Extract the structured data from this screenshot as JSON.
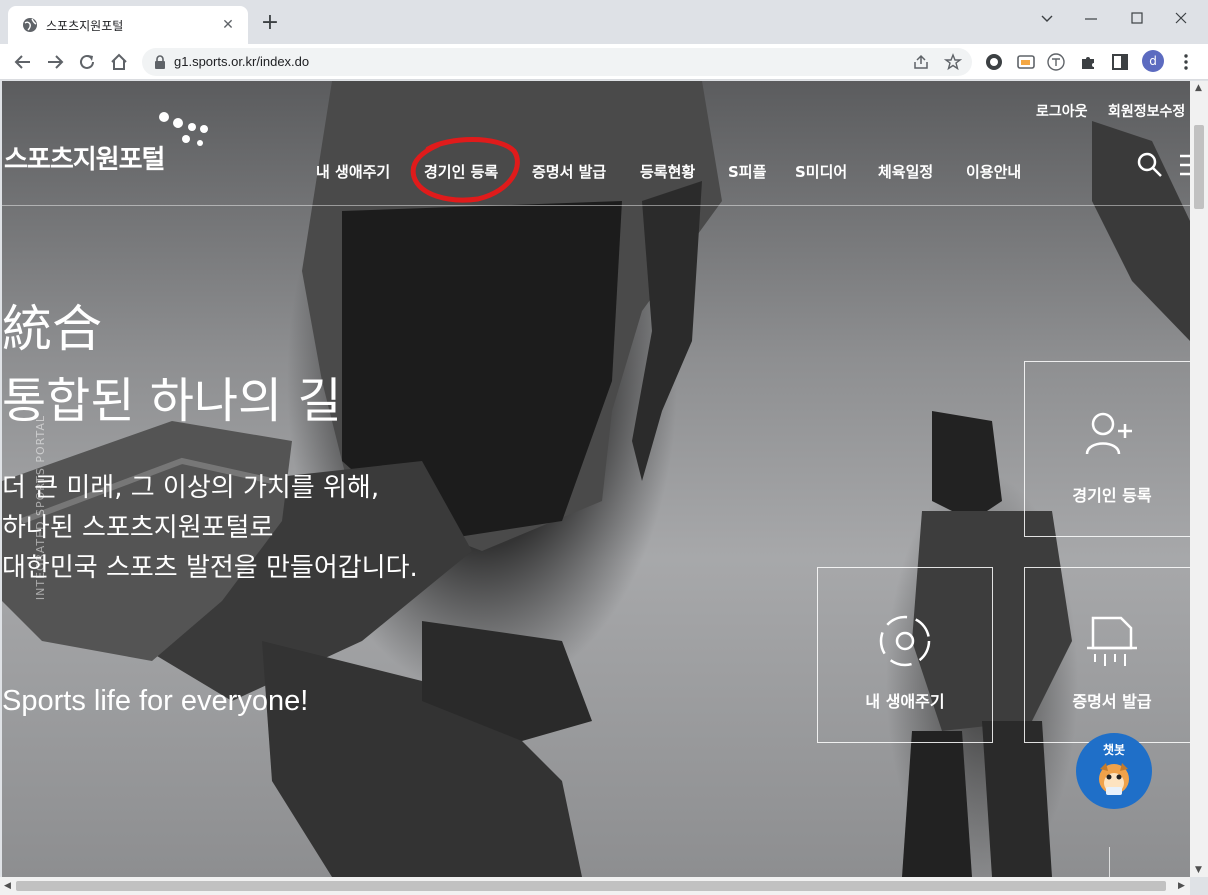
{
  "browser": {
    "tab_title": "스포츠지원포털",
    "url": "g1.sports.or.kr/index.do",
    "profile_initial": "d"
  },
  "site": {
    "logo_text": "스포츠지원포털",
    "util_links": [
      "로그아웃",
      "회원정보수정"
    ],
    "nav": [
      "내 생애주기",
      "경기인 등록",
      "증명서 발급",
      "등록현황",
      "S피플",
      "S미디어",
      "체육일정",
      "이용안내"
    ],
    "annotated_nav_item": "경기인 등록",
    "annotation_color": "#e01b1b"
  },
  "hero": {
    "hanja": "統合",
    "title": "통합된 하나의 길",
    "lines": [
      "더 큰 미래, 그 이상의 가치를 위해,",
      "하나된 스포츠지원포털로",
      "대한민국 스포츠 발전을 만들어갑니다."
    ],
    "english": "Sports life for everyone!",
    "vertical_text": "INTEGRATED SPORTS PORTAL"
  },
  "quick_links": [
    {
      "label": "경기인 등록",
      "icon": "user-add-icon"
    },
    {
      "label": "내 생애주기",
      "icon": "lifecycle-icon"
    },
    {
      "label": "증명서 발급",
      "icon": "certificate-icon"
    }
  ],
  "chatbot": {
    "label": "챗봇",
    "color": "#1f6fc8"
  }
}
